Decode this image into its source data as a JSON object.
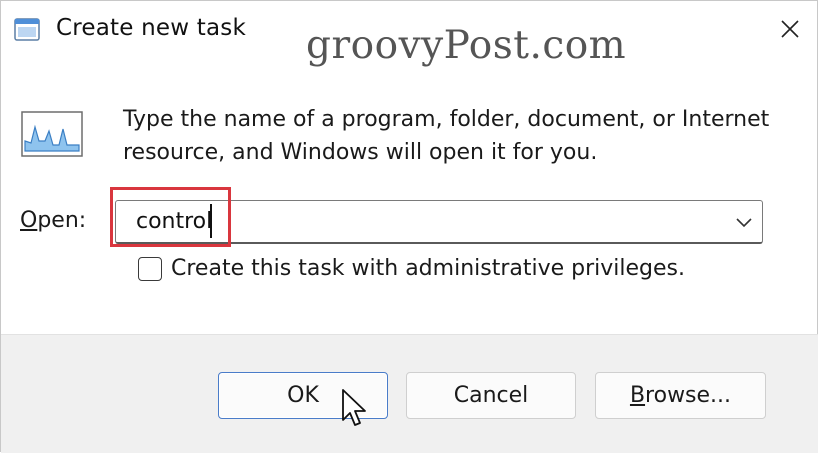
{
  "window": {
    "title": "Create new task",
    "watermark": "groovyPost.com",
    "icon": "task-manager-icon",
    "close_icon": "close-icon"
  },
  "body": {
    "description": "Type the name of a program, folder, document, or Internet resource, and Windows will open it for you.",
    "open_label_underlined": "O",
    "open_label_rest": "pen:",
    "open_value": "control",
    "admin_checkbox_label": "Create this task with administrative privileges.",
    "admin_checkbox_checked": false
  },
  "buttons": {
    "ok": "OK",
    "cancel": "Cancel",
    "browse_underlined": "B",
    "browse_rest": "rowse..."
  },
  "colors": {
    "highlight_box": "#d9363e",
    "ok_button_border": "#4a7cc9",
    "footer_bg": "#f0f0f0"
  }
}
